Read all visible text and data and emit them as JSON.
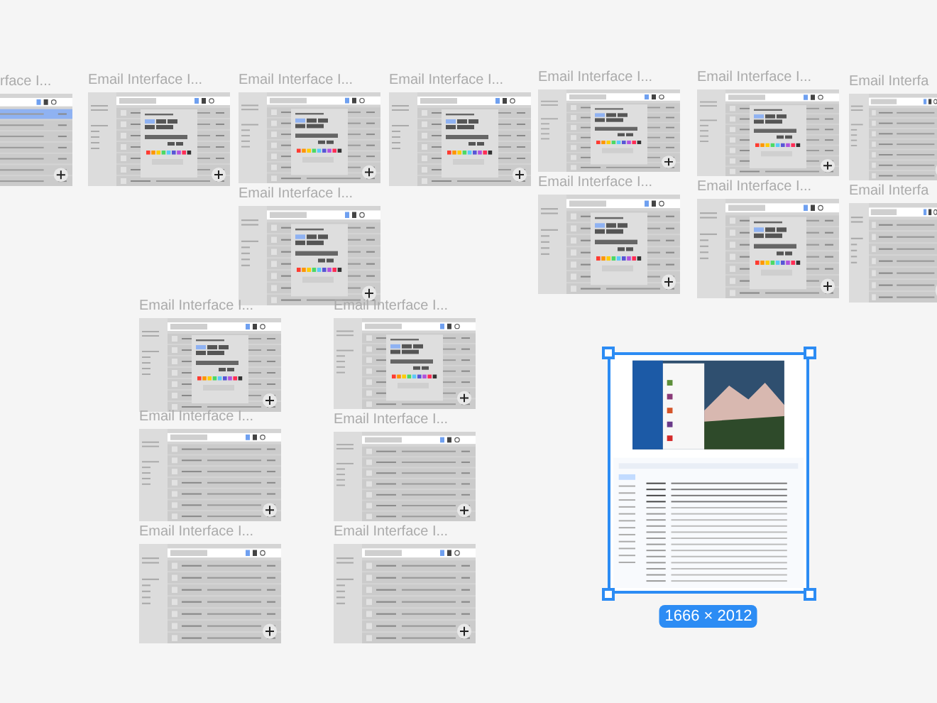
{
  "frames": [
    {
      "label": "rface I...",
      "kind": "highlighted",
      "selected": false
    },
    {
      "label": "Email Interface I...",
      "kind": "dialog",
      "selected": false
    },
    {
      "label": "Email Interface I...",
      "kind": "dialog",
      "selected": false
    },
    {
      "label": "Email Interface I...",
      "kind": "dialog",
      "selected": false
    },
    {
      "label": "Email Interface I...",
      "kind": "dialog",
      "selected": false
    },
    {
      "label": "Email Interface I...",
      "kind": "dialog",
      "selected": false
    },
    {
      "label": "Email Interfa",
      "kind": "list",
      "selected": false
    },
    {
      "label": "Email Interface I...",
      "kind": "dialog",
      "selected": false
    },
    {
      "label": "Email Interface I...",
      "kind": "dialog",
      "selected": false
    },
    {
      "label": "Email Interface I...",
      "kind": "dialog",
      "selected": false
    },
    {
      "label": "Email Interfa",
      "kind": "list",
      "selected": false
    },
    {
      "label": "Email Interface I...",
      "kind": "dialog",
      "selected": false
    },
    {
      "label": "Email Interface I...",
      "kind": "dialog",
      "selected": false
    },
    {
      "label": "Email Interface I...",
      "kind": "list",
      "selected": false
    },
    {
      "label": "Email Interface I...",
      "kind": "list",
      "selected": false
    },
    {
      "label": "Email Interface I...",
      "kind": "list",
      "selected": false
    },
    {
      "label": "Email Interface I...",
      "kind": "list",
      "selected": false
    },
    {
      "kind": "mail",
      "selected": true,
      "size": "1666 × 2012"
    }
  ]
}
